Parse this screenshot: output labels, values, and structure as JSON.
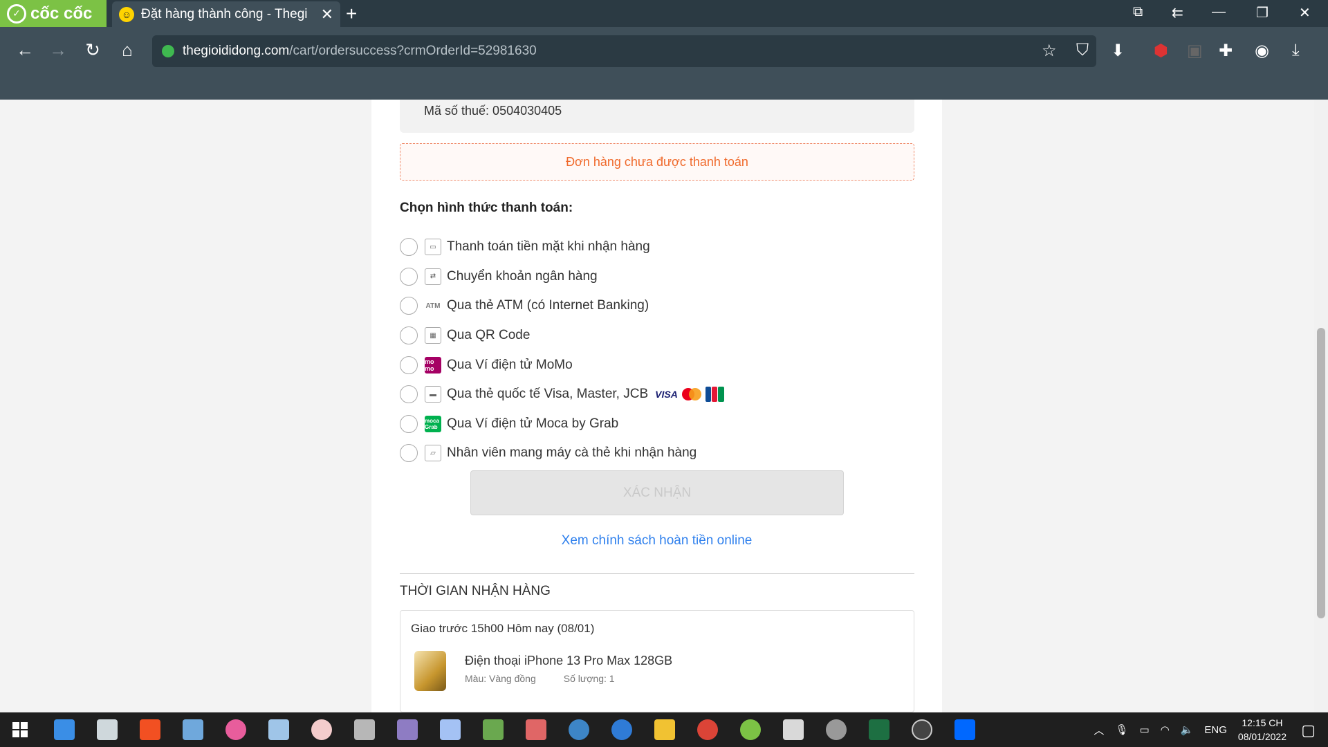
{
  "browser": {
    "brand": "cốc cốc",
    "tab_title": "Đặt hàng thành công - Thegi",
    "url_host": "thegioididong.com",
    "url_path": "/cart/ordersuccess?crmOrderId=52981630"
  },
  "page": {
    "tax_id": "Mã số thuế: 0504030405",
    "unpaid_notice": "Đơn hàng chưa được thanh toán",
    "payment_heading": "Chọn hình thức thanh toán:",
    "payment_options": [
      {
        "label": "Thanh toán tiền mặt khi nhận hàng",
        "icon": "cash-icon"
      },
      {
        "label": "Chuyển khoản ngân hàng",
        "icon": "bank-transfer-icon"
      },
      {
        "label": "Qua thẻ ATM (có Internet Banking)",
        "icon": "atm-icon",
        "icon_text": "ATM"
      },
      {
        "label": "Qua QR Code",
        "icon": "qr-code-icon"
      },
      {
        "label": "Qua Ví điện tử MoMo",
        "icon": "momo-icon",
        "icon_text": "mo mo"
      },
      {
        "label": "Qua thẻ quốc tế Visa, Master, JCB",
        "icon": "credit-card-icon"
      },
      {
        "label": "Qua Ví điện tử Moca by Grab",
        "icon": "moca-icon",
        "icon_text": "moca Grab"
      },
      {
        "label": "Nhân viên mang máy cà thẻ khi nhận hàng",
        "icon": "card-swipe-icon"
      }
    ],
    "card_brands": {
      "visa": "VISA",
      "master": "MASTER"
    },
    "confirm_button": "XÁC NHẬN",
    "refund_link": "Xem chính sách hoàn tiền online",
    "delivery_heading": "THỜI GIAN NHẬN HÀNG",
    "delivery_when": "Giao trước 15h00 Hôm nay (08/01)",
    "product_name": "Điện thoại iPhone 13 Pro Max 128GB",
    "product_color": "Màu: Vàng đồng",
    "product_qty": "Số lượng: 1"
  },
  "taskbar": {
    "language": "ENG",
    "time": "12:15 CH",
    "date": "08/01/2022"
  },
  "colors": {
    "brand_green": "#7cc245",
    "chrome_dark": "#2b3a43",
    "chrome_mid": "#3f4f59",
    "notice_orange": "#f06a2c",
    "link_blue": "#2f80ed"
  }
}
